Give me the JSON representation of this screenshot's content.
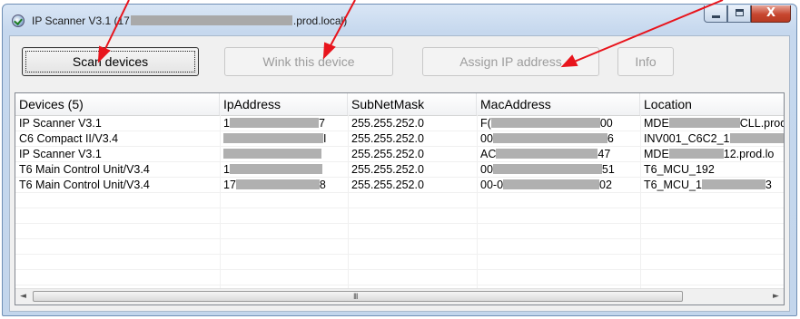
{
  "window": {
    "title_prefix": "IP Scanner V3.1 (17",
    "title_suffix": ".prod.local)",
    "close_glyph": "X"
  },
  "toolbar": {
    "scan_label": "Scan devices",
    "wink_label": "Wink this device",
    "assign_label": "Assign IP address",
    "info_label": "Info"
  },
  "table": {
    "columns": [
      "Devices (5)",
      "IpAddress",
      "SubNetMask",
      "MacAddress",
      "Location"
    ],
    "rows": [
      {
        "device": "IP Scanner V3.1",
        "ip_a": "1",
        "ip_b": "7",
        "mask": "255.255.252.0",
        "mac_a": "F(",
        "mac_b": "00",
        "loc_a": "MDE",
        "loc_b": "CLL.prod"
      },
      {
        "device": "C6 Compact II/V3.4",
        "ip_a": "",
        "ip_b": "I",
        "mask": "255.255.252.0",
        "mac_a": "00",
        "mac_b": "6",
        "loc_a": "INV001_C6C2_1",
        "loc_b": ""
      },
      {
        "device": "IP Scanner V3.1",
        "ip_a": "",
        "ip_b": "",
        "mask": "255.255.252.0",
        "mac_a": "AC",
        "mac_b": "47",
        "loc_a": "MDE",
        "loc_b": "12.prod.lo"
      },
      {
        "device": "T6 Main Control Unit/V3.4",
        "ip_a": "1",
        "ip_b": "",
        "mask": "255.255.252.0",
        "mac_a": "00",
        "mac_b": "51",
        "loc_a": "T6_MCU_192",
        "loc_b": ""
      },
      {
        "device": "T6 Main Control Unit/V3.4",
        "ip_a": "17",
        "ip_b": "8",
        "mask": "255.255.252.0",
        "mac_a": "00-0",
        "mac_b": "02",
        "loc_a": "T6_MCU_1",
        "loc_b": "3"
      }
    ]
  },
  "scrollbar": {
    "left_glyph": "◄",
    "right_glyph": "►",
    "grip_glyph": "III"
  },
  "colors": {
    "annotation_arrow": "#e8141c",
    "redaction": "#b0b0b0"
  }
}
